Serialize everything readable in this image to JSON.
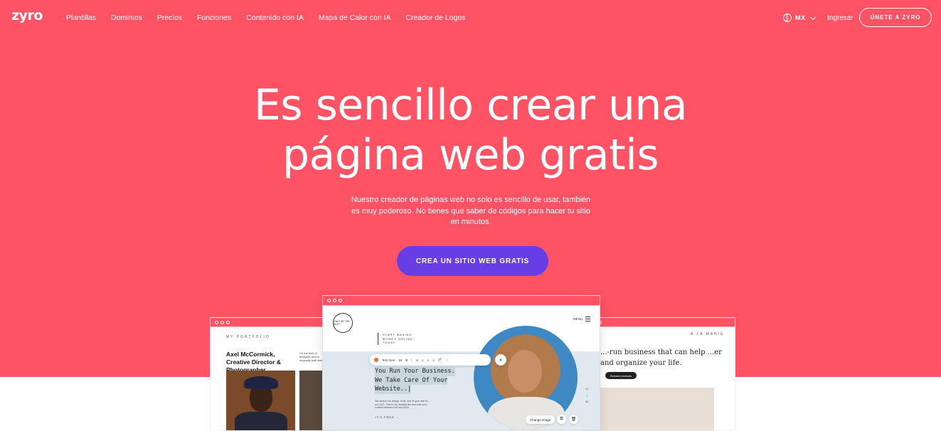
{
  "nav": {
    "logo": "zyro",
    "links": [
      "Plantillas",
      "Dominios",
      "Precios",
      "Funciones",
      "Contenido con IA",
      "Mapa de Calor con IA",
      "Creador de Logos"
    ],
    "language": "MX",
    "login": "Ingresar",
    "join": "ÚNETE A ZYRO"
  },
  "hero": {
    "title_line1": "Es sencillo crear una",
    "title_line2": "página web gratis",
    "subtitle": "Nuestro creador de páginas web no solo es sencillo de usar, también es muy poderoso. No tienes que saber de códigos para hacer tu sitio en minutos.",
    "cta": "CREA UN SITIO WEB GRATIS"
  },
  "mock_left": {
    "label": "MY PORTFOLIO",
    "name": "Axel McCormick, Creative Director & Photographer",
    "small": "I'm the kind of designer who is originally built around"
  },
  "mock_center": {
    "logo_text": "ONLY BE THE BEST",
    "menu": "MENU",
    "tagline": "START MAKING MONEY ONLINE, TODAY",
    "toolbar_label": "Text Size",
    "toolbar_value": "16",
    "toolbar_buttons": [
      "B",
      "I",
      "U",
      "≡",
      "≡",
      "≡",
      "🔗",
      "⋮"
    ],
    "heading_line1": "You Run Your Business.",
    "heading_line2": "We Take Care Of Your",
    "heading_line3": "Website..|",
    "body": "We search our design, build, and fix your site for you 24/7. There's no monthly fee and rank your content between 000 and 0000.",
    "link": "IT'S FREE →",
    "side_numbers": [
      "01",
      "|",
      "02"
    ],
    "change_image": "Change image"
  },
  "mock_right": {
    "label": "A LA MANIE",
    "text": "...-run business that can help ...er and organize your life.",
    "button": "Browse products"
  },
  "colors": {
    "hero_bg": "#fd5365",
    "cta_bg": "#673de6"
  }
}
